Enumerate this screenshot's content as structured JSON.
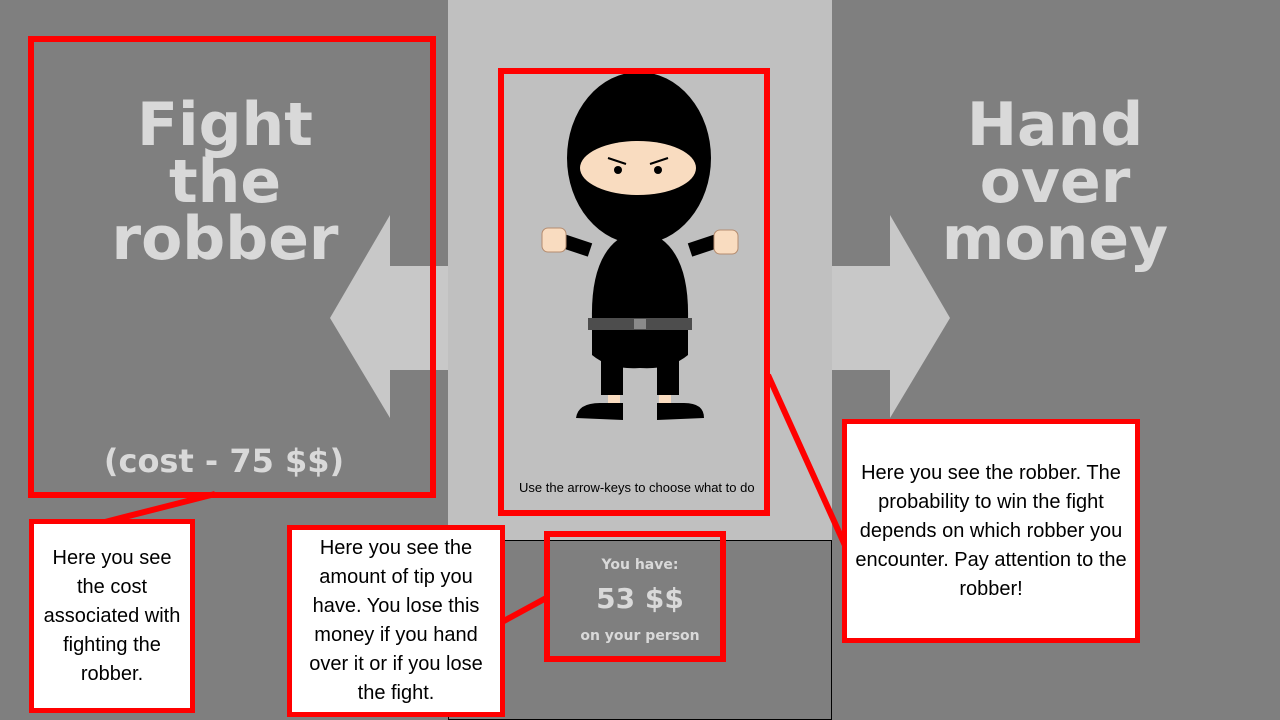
{
  "left_option": {
    "title": "Fight the robber",
    "cost": "(cost - 75 $$)"
  },
  "right_option": {
    "title": "Hand over money"
  },
  "instruction": "Use the arrow-keys to choose what to do",
  "wallet": {
    "label_top": "You have:",
    "amount": "53 $$",
    "label_bottom": "on your person"
  },
  "callouts": {
    "cost": "Here you see the cost associated with fighting the robber.",
    "tip": "Here you see the amount of tip you have. You lose this money if you hand over it or if you lose the fight.",
    "robber": "Here you see the robber. The probability to win the fight depends on which robber you encounter. Pay attention to the robber!"
  },
  "colors": {
    "background": "#7f7f7f",
    "center_panel": "#c0c0c0",
    "highlight": "#ff0000",
    "option_text": "#d9d9d9",
    "arrow": "#c8c8c8"
  },
  "icons": {
    "left_arrow": "arrow-left-icon",
    "right_arrow": "arrow-right-icon",
    "robber": "ninja-robber-figure"
  }
}
